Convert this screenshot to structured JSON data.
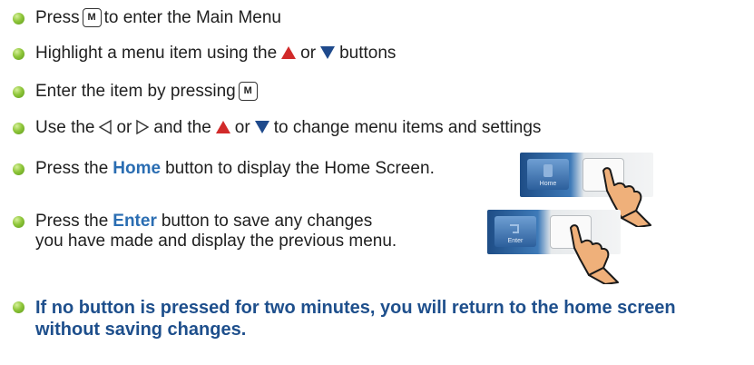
{
  "colors": {
    "bullet": "#8fc63a",
    "highlight": "#2a6db2",
    "note": "#1e4f8c",
    "up_arrow": "#d12a2a",
    "down_arrow": "#1f4a8c",
    "hand": "#efb07a"
  },
  "icons": [
    "bullet-icon",
    "m-key-icon",
    "up-triangle-icon",
    "down-triangle-icon",
    "left-triangle-icon",
    "right-triangle-icon",
    "pointing-hand-icon"
  ],
  "steps": {
    "s1": {
      "before": "Press",
      "key": "M",
      "after": "to enter the Main Menu"
    },
    "s2": {
      "before": "Highlight a menu item using the",
      "or": "or",
      "after": "buttons"
    },
    "s3": {
      "before": "Enter the item by pressing",
      "key": "M"
    },
    "s4": {
      "before": "Use the",
      "or1": "or",
      "mid": "and the",
      "or2": "or",
      "after": "to change menu items and settings"
    },
    "s5": {
      "before": "Press the",
      "highlight": "Home",
      "after": "button to display the Home Screen."
    },
    "s6": {
      "before": "Press the",
      "highlight": "Enter",
      "after": "button to save any changes",
      "line2": "you have made and display the previous menu."
    },
    "note": {
      "line1": "If no button is pressed for two minutes, you will return to the home screen",
      "line2": "without saving changes."
    }
  },
  "panels": {
    "home_label": "Home",
    "enter_label": "Enter"
  }
}
